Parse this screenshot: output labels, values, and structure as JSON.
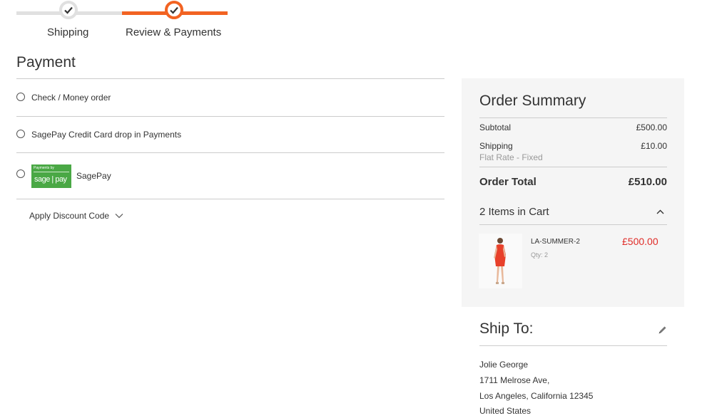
{
  "progress": {
    "steps": [
      {
        "label": "Shipping",
        "state": "complete"
      },
      {
        "label": "Review & Payments",
        "state": "active"
      }
    ],
    "accent_color": "#f26322"
  },
  "payment": {
    "title": "Payment",
    "methods": [
      {
        "label": "Check / Money order",
        "selected": false
      },
      {
        "label": "SagePay Credit Card drop in Payments",
        "selected": false
      },
      {
        "label": "SagePay",
        "selected": false,
        "logo_text_top": "Payments by",
        "logo_text_brand": "sage | pay"
      }
    ],
    "discount_label": "Apply Discount Code"
  },
  "summary": {
    "title": "Order Summary",
    "subtotal_label": "Subtotal",
    "subtotal_value": "£500.00",
    "shipping_label": "Shipping",
    "shipping_value": "£10.00",
    "shipping_method": "Flat Rate - Fixed",
    "total_label": "Order Total",
    "total_value": "£510.00",
    "items_label": "2 Items in Cart",
    "items": [
      {
        "name": "LA-SUMMER-2",
        "qty": "Qty: 2",
        "price": "£500.00",
        "image": "red-dress-thumbnail"
      }
    ]
  },
  "ship_to": {
    "title": "Ship To:",
    "name": "Jolie George",
    "street": "1711 Melrose Ave,",
    "city_line": "Los Angeles, California 12345",
    "country": "United States"
  }
}
